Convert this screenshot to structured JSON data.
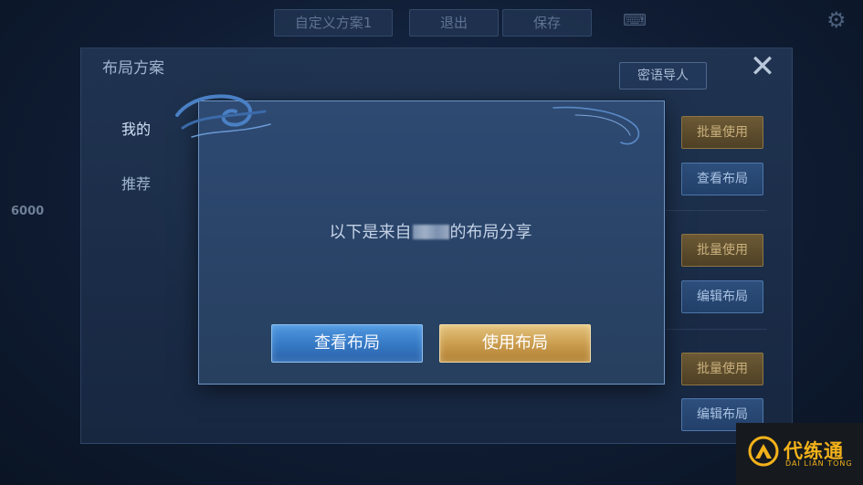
{
  "topbar": {
    "custom_plan_label": "自定义方案1",
    "exit_label": "退出",
    "save_label": "保存"
  },
  "background_panel": {
    "title": "布局方案",
    "tabs": [
      "我的",
      "推荐"
    ],
    "secret_import_label": "密语导人",
    "side_buttons": [
      "批量使用",
      "查看布局",
      "批量使用",
      "编辑布局",
      "批量使用",
      "编辑布局"
    ],
    "coin_count": "6000"
  },
  "modal": {
    "message_prefix": "以下是来自",
    "message_suffix": "的布局分享",
    "view_button": "查看布局",
    "use_button": "使用布局"
  },
  "watermark": {
    "name_cn": "代练通",
    "name_en": "DAI LIAN TONG"
  },
  "colors": {
    "primary_blue": "#3578c4",
    "gold": "#c99b4c",
    "watermark_yellow": "#f3b21a"
  }
}
